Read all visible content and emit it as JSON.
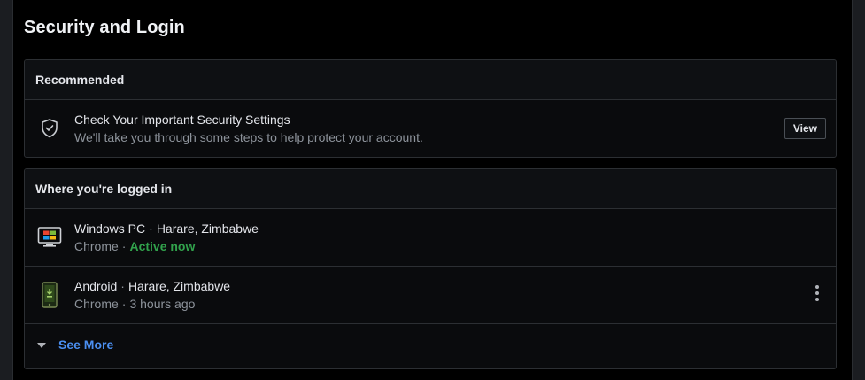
{
  "page": {
    "title": "Security and Login"
  },
  "recommended": {
    "header": "Recommended",
    "item": {
      "icon": "shield-check-icon",
      "title": "Check Your Important Security Settings",
      "subtitle": "We'll take you through some steps to help protect your account.",
      "button_label": "View"
    }
  },
  "logged_in": {
    "header": "Where you're logged in",
    "sessions": [
      {
        "icon": "desktop-windows-icon",
        "device": "Windows PC",
        "location": "Harare, Zimbabwe",
        "browser": "Chrome",
        "status": "Active now"
      },
      {
        "icon": "android-phone-icon",
        "device": "Android",
        "location": "Harare, Zimbabwe",
        "browser": "Chrome",
        "status": "3 hours ago"
      }
    ],
    "more_icon": "more-vertical-icon",
    "see_more_label": "See More"
  },
  "colors": {
    "background": "#000000",
    "card": "#0a0b0d",
    "border": "#2c2f33",
    "active": "#31a24c",
    "link": "#4b8ff0",
    "secondary_text": "#8d939b"
  }
}
